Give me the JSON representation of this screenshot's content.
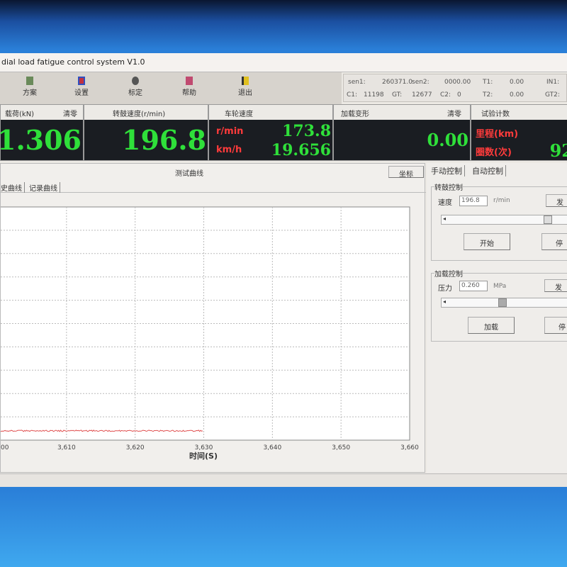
{
  "window": {
    "title": "dial load fatigue control system V1.0"
  },
  "toolbar": [
    {
      "label": "方案",
      "icon": "scheme-icon"
    },
    {
      "label": "设置",
      "icon": "settings-icon"
    },
    {
      "label": "标定",
      "icon": "calibrate-icon"
    },
    {
      "label": "帮助",
      "icon": "help-icon"
    },
    {
      "label": "退出",
      "icon": "exit-icon"
    }
  ],
  "sensors": {
    "sen1_label": "sen1:",
    "sen1": "260371.0",
    "sen2_label": "sen2:",
    "sen2": "0000.00",
    "t1_label": "T1:",
    "t1": "0.00",
    "in1_label": "IN1:",
    "c1_label": "C1:",
    "c1": "11198",
    "gt_label": "GT:",
    "gt": "12677",
    "c2_label": "C2:",
    "c2": "0",
    "t2_label": "T2:",
    "t2": "0.00",
    "gt2_label": "GT2:"
  },
  "readouts": {
    "load": {
      "label": "载荷(kN)",
      "zero": "清零",
      "value": "1.306"
    },
    "speed": {
      "label": "转鼓速度(r/min)",
      "value": "196.8"
    },
    "wheel": {
      "label": "车轮速度",
      "unit1": "r/min",
      "value1": "173.8",
      "unit2": "km/h",
      "value2": "19.656"
    },
    "deform": {
      "label": "加载变形",
      "zero": "清零",
      "value": "0.00"
    },
    "count": {
      "label": "试验计数",
      "mileage": "里程(km)",
      "cycles": "圈数(次)",
      "cycles_value": "92"
    }
  },
  "chart_panel": {
    "title": "测试曲线",
    "coord_button": "坐标",
    "tabs": [
      "史曲线",
      "记录曲线"
    ]
  },
  "chart_data": {
    "type": "line",
    "xlabel": "时间(S)",
    "ylabel": "",
    "xlim": [
      3600,
      3660
    ],
    "xticks": [
      "00",
      "3,610",
      "3,620",
      "3,630",
      "3,640",
      "3,650",
      "3,660"
    ],
    "grid": true,
    "series": [
      {
        "name": "load",
        "color": "#e05050",
        "x_start": 3600,
        "x_end": 3630,
        "level_fraction": 0.04
      }
    ]
  },
  "control": {
    "tabs": [
      "手动控制",
      "自动控制"
    ],
    "speed": {
      "group": "转鼓控制",
      "label": "速度",
      "value": "196.8",
      "unit": "r/min",
      "send": "发",
      "start": "开始",
      "stop": "停",
      "slider_fraction": 0.9
    },
    "load": {
      "group": "加载控制",
      "label": "压力",
      "value": "0.260",
      "unit": "MPa",
      "send": "发",
      "start": "加载",
      "stop": "停",
      "slider_fraction": 0.5
    }
  }
}
